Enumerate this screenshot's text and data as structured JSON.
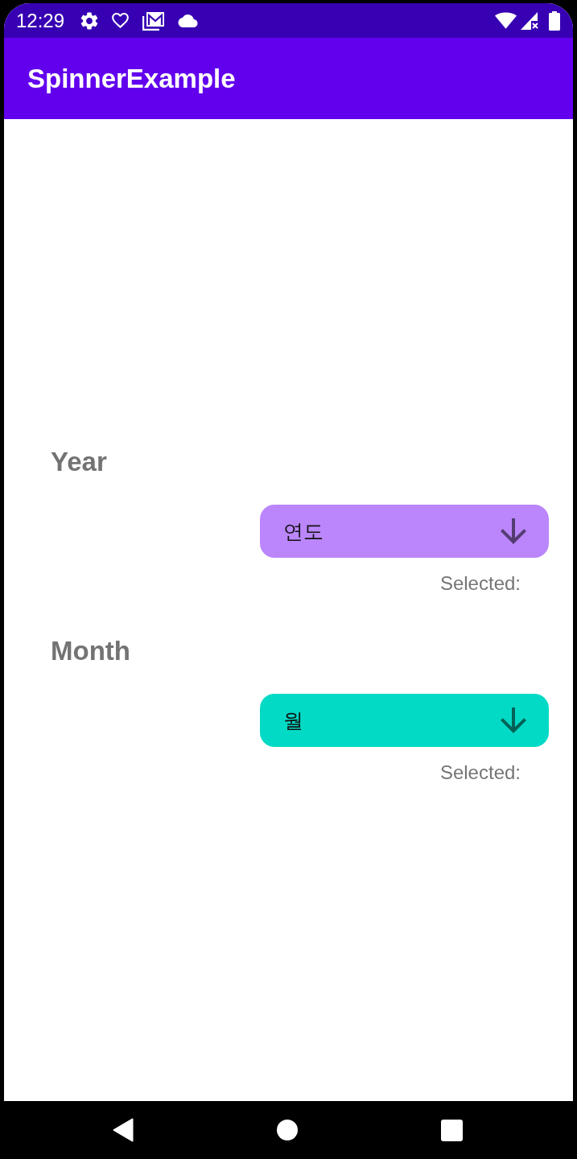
{
  "status_bar": {
    "time": "12:29"
  },
  "app_bar": {
    "title": "SpinnerExample"
  },
  "spinners": [
    {
      "label": "Year",
      "value": "연도",
      "color": "#bb86fc",
      "selected_text": "Selected:"
    },
    {
      "label": "Month",
      "value": "월",
      "color": "#03dac5",
      "selected_text": "Selected:"
    }
  ]
}
